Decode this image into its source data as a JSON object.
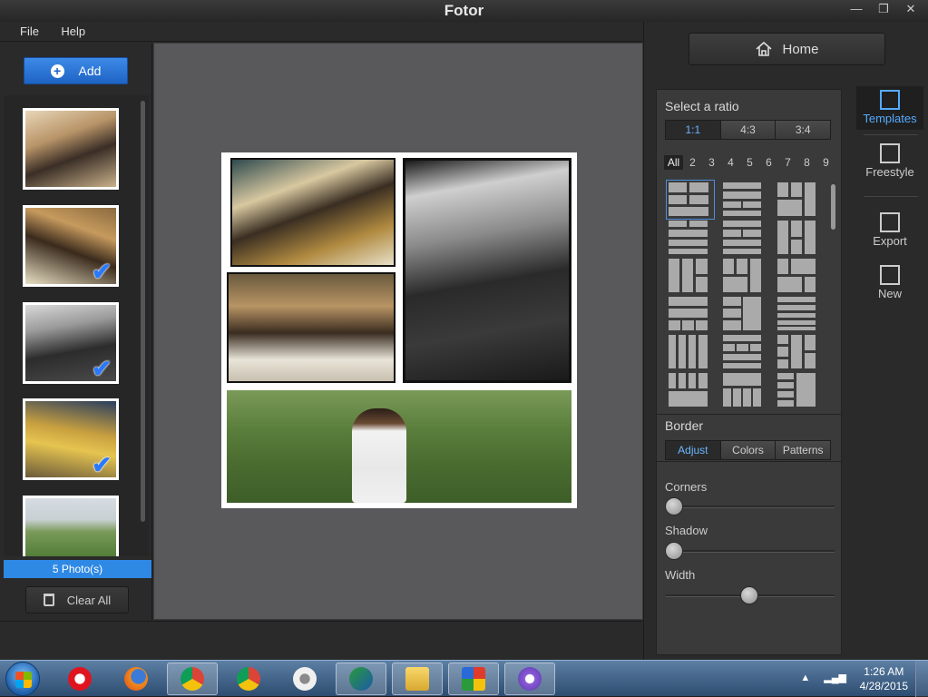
{
  "window": {
    "title": "Fotor",
    "minimize_glyph": "—",
    "maximize_glyph": "❐",
    "close_glyph": "✕"
  },
  "menu": {
    "items": [
      "File",
      "Help"
    ]
  },
  "left_panel": {
    "add_label": "Add",
    "photo_count_label": "5 Photo(s)",
    "clear_label": "Clear All",
    "check_glyph": "✔",
    "thumbnails": [
      {
        "checked": false
      },
      {
        "checked": true
      },
      {
        "checked": true
      },
      {
        "checked": true
      },
      {
        "checked": false
      }
    ]
  },
  "right_panel": {
    "home_label": "Home",
    "select_ratio_label": "Select a ratio",
    "ratios": [
      {
        "label": "1:1",
        "active": true
      },
      {
        "label": "4:3",
        "active": false
      },
      {
        "label": "3:4",
        "active": false
      }
    ],
    "photo_counts": [
      "All",
      "2",
      "3",
      "4",
      "5",
      "6",
      "7",
      "8",
      "9"
    ],
    "photo_count_selected": "All",
    "border_label": "Border",
    "border_tabs": [
      {
        "label": "Adjust",
        "active": true
      },
      {
        "label": "Colors",
        "active": false
      },
      {
        "label": "Patterns",
        "active": false
      }
    ],
    "sliders": [
      {
        "label": "Corners",
        "value": 0
      },
      {
        "label": "Shadow",
        "value": 0
      },
      {
        "label": "Width",
        "value": 0.5
      }
    ]
  },
  "tools": [
    {
      "label": "Templates",
      "icon": "templates-icon",
      "active": true
    },
    {
      "label": "Freestyle",
      "icon": "freestyle-icon",
      "active": false
    },
    {
      "label": "Export",
      "icon": "export-icon",
      "active": false
    },
    {
      "label": "New",
      "icon": "new-icon",
      "active": false
    }
  ],
  "taskbar": {
    "apps": [
      {
        "name": "opera-icon",
        "active": false
      },
      {
        "name": "firefox-icon",
        "active": false
      },
      {
        "name": "chrome-icon",
        "active": true
      },
      {
        "name": "chrome-icon",
        "active": false
      },
      {
        "name": "opera-next-icon",
        "active": false
      },
      {
        "name": "internet-download-manager-icon",
        "active": true
      },
      {
        "name": "file-explorer-icon",
        "active": true
      },
      {
        "name": "windows-security-icon",
        "active": true
      },
      {
        "name": "fotor-icon",
        "active": true
      }
    ],
    "time": "1:26 AM",
    "date": "4/28/2015"
  },
  "colors": {
    "accent": "#2e89e5",
    "active_text": "#6ab4ff",
    "canvas_bg": "#59595b"
  }
}
